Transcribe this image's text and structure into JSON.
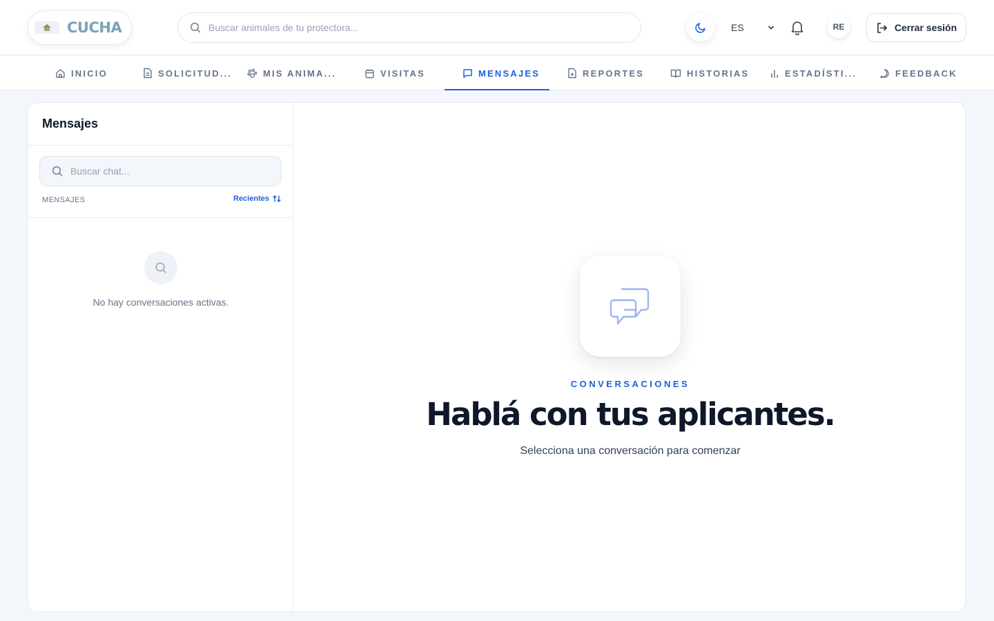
{
  "header": {
    "logo_text": "CUCHA",
    "search_placeholder": "Buscar animales de tu protectora...",
    "language": "ES",
    "avatar_initials": "RE",
    "logout_label": "Cerrar sesión"
  },
  "nav": {
    "items": [
      {
        "label": "INICIO",
        "icon": "home-icon"
      },
      {
        "label": "SOLICITUD...",
        "icon": "document-icon"
      },
      {
        "label": "MIS ANIMA...",
        "icon": "paw-icon"
      },
      {
        "label": "VISITAS",
        "icon": "calendar-icon"
      },
      {
        "label": "MENSAJES",
        "icon": "message-icon",
        "active": true
      },
      {
        "label": "REPORTES",
        "icon": "report-icon"
      },
      {
        "label": "HISTORIAS",
        "icon": "book-icon"
      },
      {
        "label": "ESTADÍSTI...",
        "icon": "bar-chart-icon"
      },
      {
        "label": "FEEDBACK",
        "icon": "comment-icon"
      }
    ]
  },
  "sidebar": {
    "title": "Mensajes",
    "search_placeholder": "Buscar chat...",
    "list_label": "MENSAJES",
    "sort_label": "Recientes",
    "empty_text": "No hay conversaciones activas."
  },
  "chat": {
    "eyebrow": "CONVERSACIONES",
    "title": "Hablá con tus aplicantes.",
    "subtitle": "Selecciona una conversación para comenzar"
  },
  "colors": {
    "accent": "#1d5fd8",
    "logo": "#7aa2b8",
    "muted": "#64748b"
  }
}
